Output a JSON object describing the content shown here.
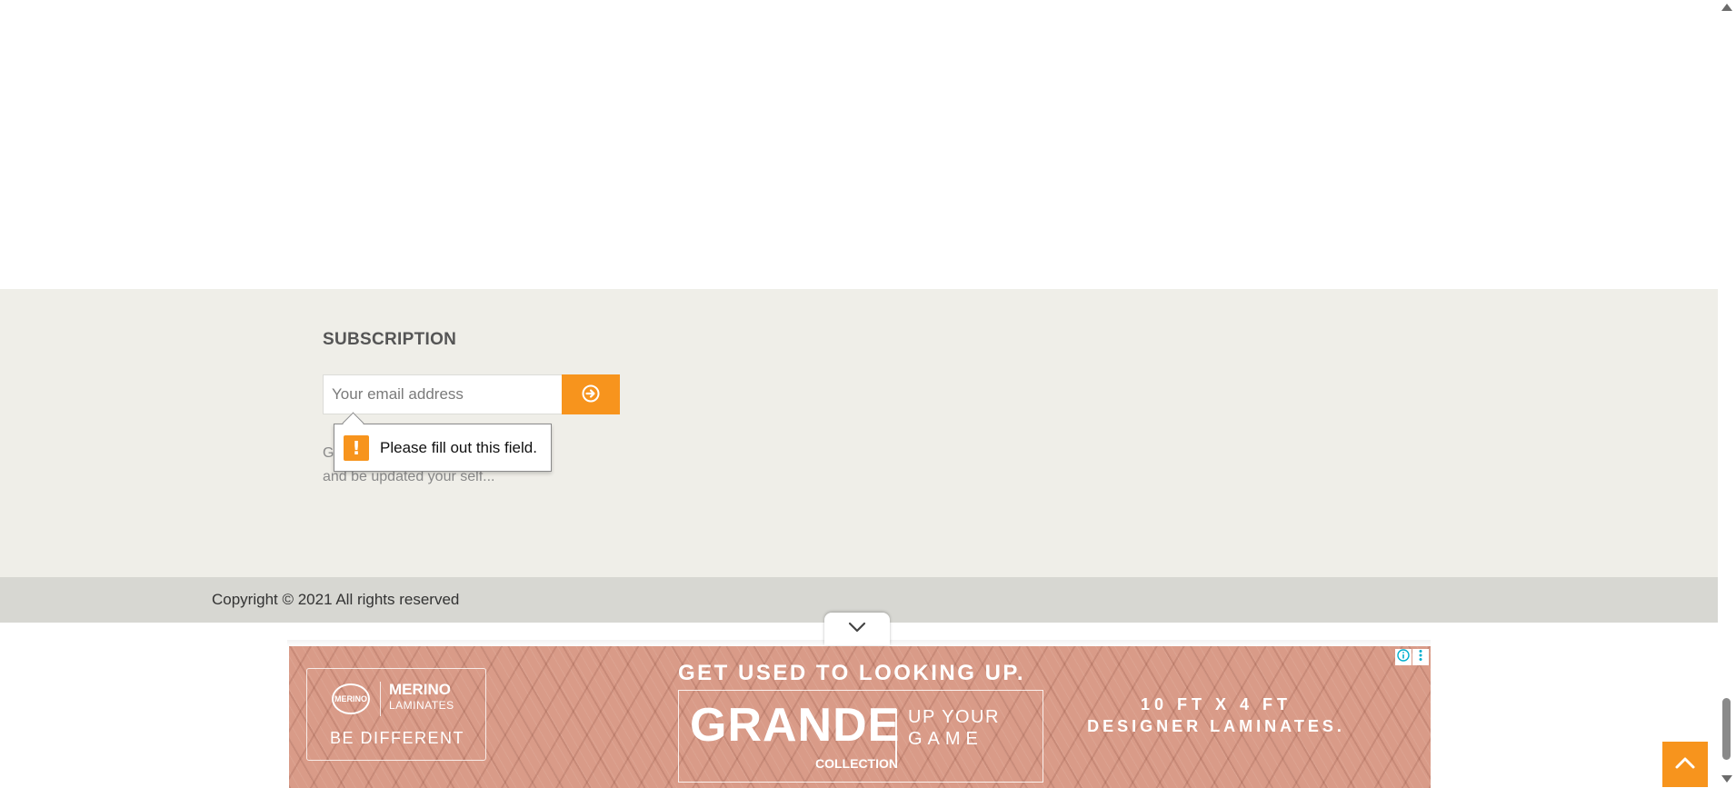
{
  "subscription": {
    "title": "SUBSCRIPTION",
    "email_placeholder": "Your email address",
    "description": "Get the latest updates from our site and be updated your self...",
    "submit_icon": "arrow-circle-right-icon"
  },
  "validation": {
    "message": "Please fill out this field.",
    "icon": "exclamation-icon"
  },
  "footer": {
    "copyright": "Copyright © 2021 All rights reserved"
  },
  "ad": {
    "logo_mark": "MERINO",
    "brand_line1": "MERINO",
    "brand_line2": "LAMINATES",
    "tagline": "BE DIFFERENT",
    "headline": "GET USED TO LOOKING UP.",
    "product": "GRANDE",
    "collection": "COLLECTION",
    "slogan_line1": "UP YOUR",
    "slogan_line2": "GAME",
    "spec_line1": "10 FT X 4 FT",
    "spec_line2": "DESIGNER LAMINATES."
  },
  "colors": {
    "accent": "#f7941d",
    "footer_band": "#efeee8",
    "copyright_bar": "#d7d7d2",
    "ad_background": "#d99b88"
  }
}
